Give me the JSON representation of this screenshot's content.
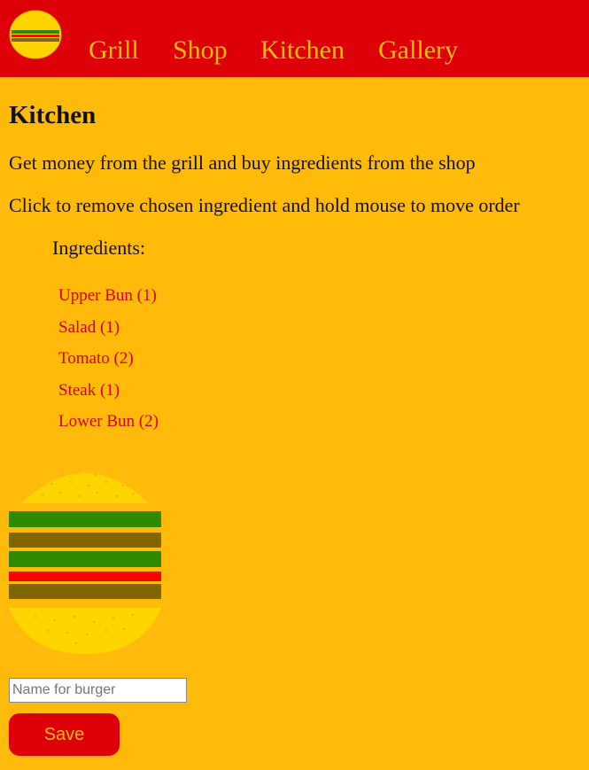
{
  "nav": {
    "logo_icon": "burger-logo-icon",
    "links": [
      "Grill",
      "Shop",
      "Kitchen",
      "Gallery"
    ]
  },
  "page": {
    "title": "Kitchen",
    "intro": "Get money from the grill and buy ingredients from the shop",
    "instructions": "Click to remove chosen ingredient and hold mouse to move order"
  },
  "ingredients": {
    "title": "Ingredients:",
    "items": [
      "Upper Bun (1)",
      "Salad (1)",
      "Tomato (2)",
      "Steak (1)",
      "Lower Bun (2)"
    ]
  },
  "burger": {
    "layers": [
      "upper-bun",
      "salad",
      "steak",
      "salad",
      "tomato",
      "steak",
      "lower-bun"
    ]
  },
  "form": {
    "name_placeholder": "Name for burger",
    "name_value": "",
    "save_label": "Save"
  },
  "colors": {
    "background": "#ffba0a",
    "topbar": "#dd0008",
    "accent_text": "#ffba0a",
    "ingredient_text": "#dd0008",
    "bun": "#ffd400",
    "salad": "#2e8b00",
    "steak": "#806600",
    "tomato": "#ff0000"
  }
}
